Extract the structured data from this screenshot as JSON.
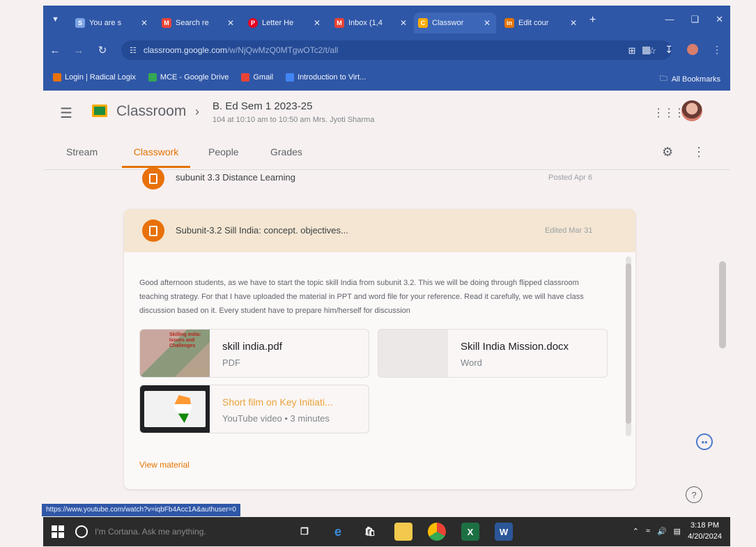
{
  "browser": {
    "tabs": [
      {
        "label": "You are s",
        "fav": "S",
        "color": "#7aa3e5"
      },
      {
        "label": "Search re",
        "fav": "M",
        "color": "#ea4335"
      },
      {
        "label": "Letter He",
        "fav": "P",
        "color": "#e60023"
      },
      {
        "label": "Inbox (1,4",
        "fav": "M",
        "color": "#ea4335"
      },
      {
        "label": "Classwor",
        "fav": "C",
        "color": "#f9ab00"
      },
      {
        "label": "Edit cour",
        "fav": "in",
        "color": "#e37400"
      }
    ],
    "new_tab": "+",
    "url_main": "classroom.google.com",
    "url_rest": "/w/NjQwMzQ0MTgwOTc2/t/all",
    "bookmarks": [
      {
        "label": "Login | Radical Logix",
        "color": "#e8710a"
      },
      {
        "label": "MCE - Google Drive",
        "color": "#34a853"
      },
      {
        "label": "Gmail",
        "color": "#ea4335"
      },
      {
        "label": "Introduction to Virt...",
        "color": "#4285f4"
      }
    ],
    "all_bookmarks": "All Bookmarks"
  },
  "header": {
    "app_name": "Classroom",
    "class_title": "B. Ed Sem 1 2023-25",
    "class_subtitle": "104 at 10:10 am to 10:50 am Mrs. Jyoti Sharma"
  },
  "nav": {
    "tabs": [
      "Stream",
      "Classwork",
      "People",
      "Grades"
    ],
    "active": "Classwork"
  },
  "items": [
    {
      "title": "subunit 3.3 Distance Learning",
      "date": "Posted Apr 6"
    },
    {
      "title": "Subunit-3.2 Sill India: concept. objectives...",
      "date": "Edited Mar 31"
    }
  ],
  "material": {
    "description": "Good afternoon students, as we have to start the topic skill India from subunit 3.2. This we will be doing through flipped classroom teaching strategy. For that I have uploaded the material in PPT and word file for your reference. Read it carefully, we will have class discussion based on it. Every student have to prepare him/herself for discussion",
    "attachments": [
      {
        "name": "skill india.pdf",
        "type": "PDF"
      },
      {
        "name": "Skill India Mission.docx",
        "type": "Word"
      },
      {
        "name": "Short film on Key Initiati...",
        "type": "YouTube video • 3 minutes"
      }
    ],
    "thumb_text": "Skilling India: Issues and Challenges",
    "view_link": "View material"
  },
  "status_url": "https://www.youtube.com/watch?v=iqbFb4Acc1A&authuser=0",
  "taskbar": {
    "cortana": "I'm Cortana. Ask me anything.",
    "time": "3:18 PM",
    "date": "4/20/2024"
  },
  "icons": [
    "menu-icon",
    "apps-icon",
    "settings-icon",
    "more-vert-icon",
    "assignment-icon",
    "help-icon",
    "keep-icon",
    "windows-icon",
    "cortana-icon",
    "edge-icon",
    "chrome-icon",
    "excel-icon",
    "word-icon"
  ]
}
